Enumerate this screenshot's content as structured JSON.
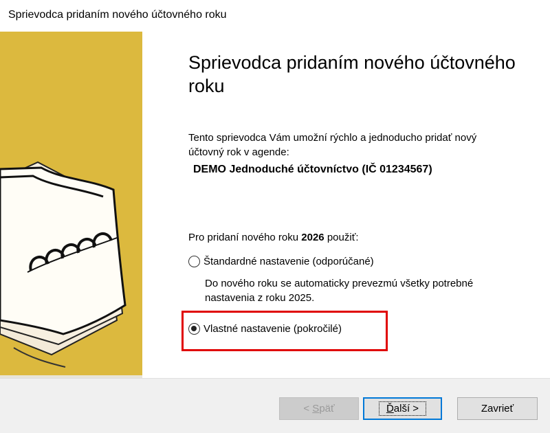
{
  "window": {
    "title": "Sprievodca pridaním nového účtovného roku"
  },
  "wizard": {
    "heading": "Sprievodca pridaním nového účtovného roku",
    "intro": "Tento sprievodca Vám umožní rýchlo a jednoducho pridať nový účtovný rok v agende:",
    "agenda_name": "DEMO Jednoduché účtovníctvo (IČ 01234567)",
    "year_prefix": "Pro pridaní nového roku",
    "year": "2026",
    "year_suffix": "použiť:",
    "options": [
      {
        "label": "Štandardné nastavenie (odporúčané)",
        "description": "Do nového roku se automaticky prevezmú všetky potrebné nastavenia z roku 2025.",
        "selected": false
      },
      {
        "label": "Vlastné nastavenie (pokročilé)",
        "selected": true
      }
    ],
    "highlight_color": "#e00000",
    "sidebar_color": "#dcb93e"
  },
  "buttons": {
    "back": {
      "prefix": "< ",
      "mnemonic": "S",
      "rest": "päť",
      "enabled": false
    },
    "next": {
      "mnemonic": "Ď",
      "rest": "alší",
      "suffix": " >"
    },
    "close": {
      "label": "Zavrieť"
    }
  },
  "icons": {
    "sidebar_art": "notepad-icon"
  }
}
